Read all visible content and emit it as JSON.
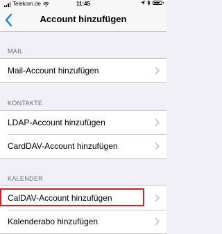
{
  "status_bar": {
    "carrier": "Telekom.de",
    "time": "11:45"
  },
  "nav": {
    "title": "Account hinzufügen"
  },
  "sections": {
    "mail": {
      "header": "MAIL",
      "items": [
        "Mail-Account hinzufügen"
      ]
    },
    "kontakte": {
      "header": "KONTAKTE",
      "items": [
        "LDAP-Account hinzufügen",
        "CardDAV-Account hinzufügen"
      ]
    },
    "kalender": {
      "header": "KALENDER",
      "items": [
        "CalDAV-Account hinzufügen",
        "Kalenderabo hinzufügen"
      ],
      "highlighted_item": "CalDAV-Account hinzufügen"
    }
  },
  "colors": {
    "accent": "#007aff",
    "highlight": "#e11b1b",
    "background": "#efeff4"
  }
}
